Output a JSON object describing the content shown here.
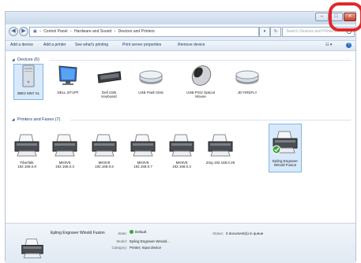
{
  "window": {
    "controls": {
      "minimize": "–",
      "maximize": "□",
      "close": "✕"
    }
  },
  "nav": {
    "back": "◀",
    "forward": "▶",
    "breadcrumb": [
      "Control Panel",
      "Hardware and Sound",
      "Devices and Printers"
    ],
    "refresh_label": "↻",
    "search_placeholder": "Search Devices and Printers"
  },
  "toolbar": {
    "items": [
      "Add a device",
      "Add a printer",
      "See what's printing",
      "Print server properties",
      "Remove device"
    ],
    "view_label": "☷ ▾",
    "help_label": "?"
  },
  "devices": {
    "header": "Devices (6)",
    "items": [
      {
        "name": "2BE2 MN7 SL",
        "icon": "computer-icon"
      },
      {
        "name": "DELL 2IT1PF",
        "icon": "monitor-icon"
      },
      {
        "name": "Dell USB Keyboard",
        "icon": "keyboard-icon"
      },
      {
        "name": "USB Flash Disk",
        "icon": "drive-icon"
      },
      {
        "name": "USB-PS/2 Optical Mouse",
        "icon": "mouse-icon"
      },
      {
        "name": "JD FIREFLY",
        "icon": "drive-icon"
      }
    ]
  },
  "printers": {
    "header": "Printers and Faxes (7)",
    "items": [
      {
        "name": "Fiberfalk 192.168.0.8"
      },
      {
        "name": "MK9V8 192.168.0.3"
      },
      {
        "name": "MK9V8 192.168.0.6"
      },
      {
        "name": "MK9V8 192.168.0.7"
      },
      {
        "name": "MK9V8 192.168.0.3"
      },
      {
        "name": "Zing 192.168.0.28"
      },
      {
        "name": "Epling Engraver Winold Fusion"
      }
    ]
  },
  "details": {
    "name": "Epling Engraver Winold Fusion",
    "state_key": "State:",
    "state_val": "Default",
    "status_key": "Status:",
    "status_val": "0 document(s) in queue",
    "model_key": "Model:",
    "model_val": "Epling Engraver Winold...",
    "category_key": "Category:",
    "category_val": "Printer; Input device"
  }
}
